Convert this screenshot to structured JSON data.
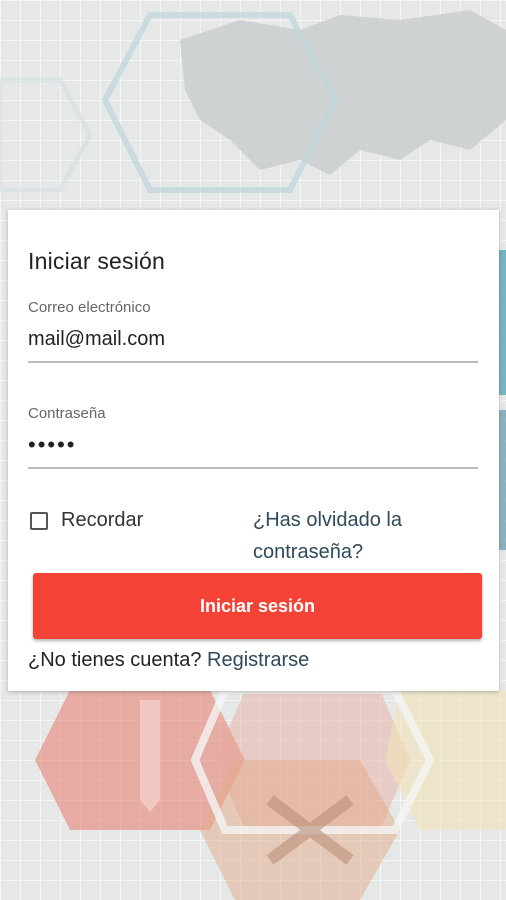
{
  "login": {
    "title": "Iniciar sesión",
    "email": {
      "label": "Correo electrónico",
      "value": "mail@mail.com"
    },
    "password": {
      "label": "Contraseña",
      "value": "•••••"
    },
    "remember_label": "Recordar",
    "forgot_link": "¿Has olvidado la contraseña?",
    "submit_label": "Iniciar sesión",
    "no_account_text": "¿No tienes cuenta?",
    "register_link": "Registrarse"
  },
  "colors": {
    "primary": "#f44336",
    "link": "#2f4a5c"
  }
}
